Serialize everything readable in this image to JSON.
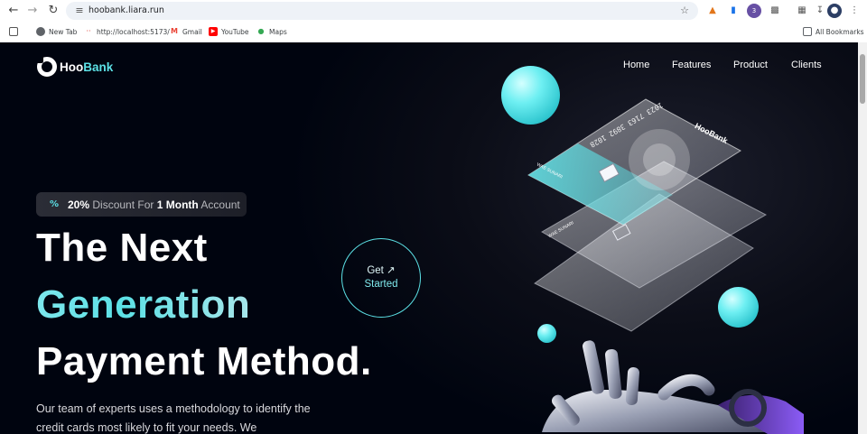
{
  "browser": {
    "url": "hoobank.liara.run",
    "bookmarks": [
      {
        "label": "New Tab"
      },
      {
        "label": "http://localhost:5173/"
      },
      {
        "label": "Gmail"
      },
      {
        "label": "YouTube"
      },
      {
        "label": "Maps"
      }
    ],
    "all_bookmarks_label": "All Bookmarks",
    "extension_badge": "3"
  },
  "site": {
    "logo": {
      "part1": "Hoo",
      "part2": "Bank"
    },
    "nav": [
      "Home",
      "Features",
      "Product",
      "Clients"
    ],
    "badge": {
      "percent": "20%",
      "text1": " Discount For ",
      "months": "1 Month",
      "text2": " Account"
    },
    "headline": {
      "line1": "The Next",
      "line2": "Generation",
      "line3": "Payment Method."
    },
    "paragraph": "Our team of experts uses a methodology to identify the credit cards most likely to fit your needs. We",
    "cta": {
      "line1": "Get ↗",
      "line2": "Started"
    },
    "card": {
      "number": "1023 7163 3892 1028",
      "brand": "HooBank",
      "holder": "WAE SUNARI"
    },
    "colors": {
      "accent": "#5ce1e6",
      "background": "#00040f"
    }
  }
}
